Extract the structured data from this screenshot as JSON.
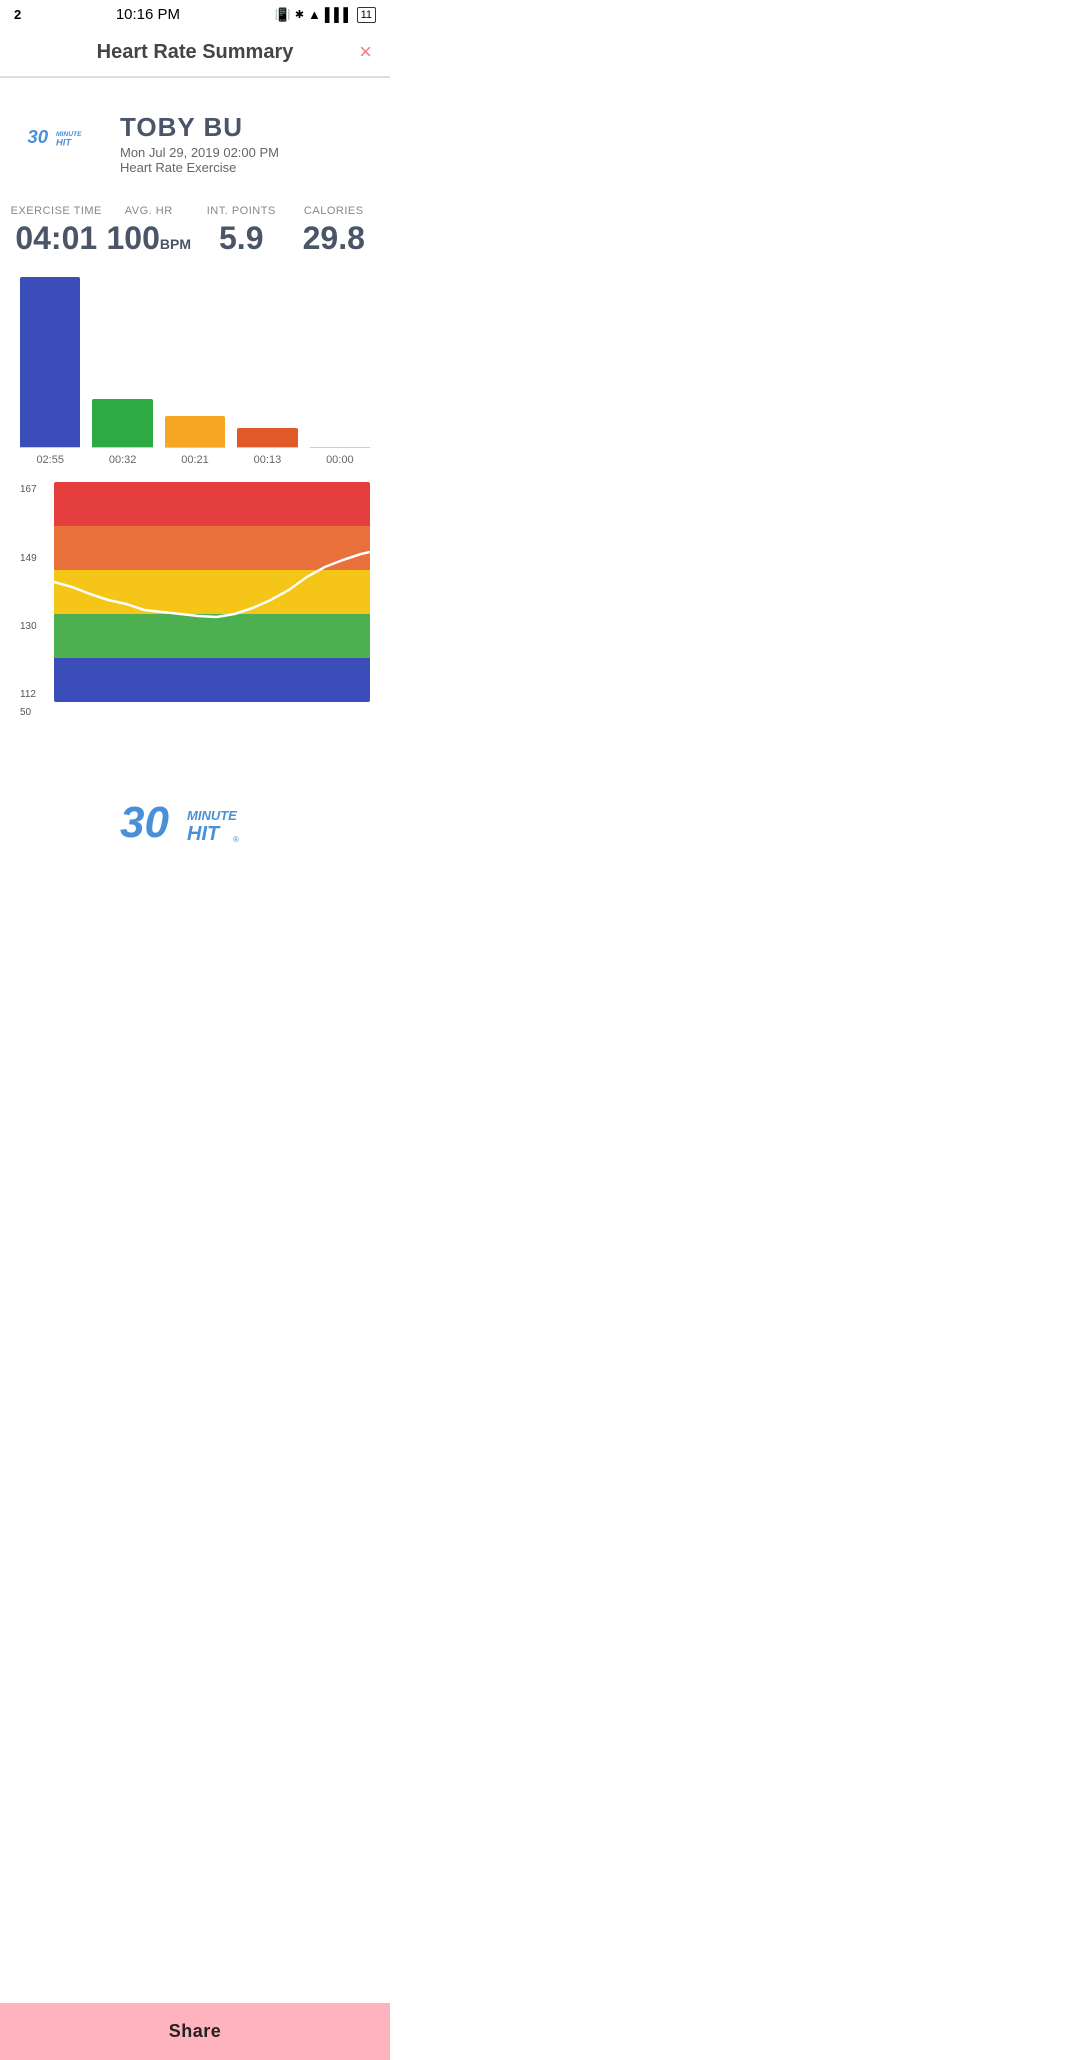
{
  "statusBar": {
    "badge": "2",
    "time": "10:16 PM",
    "battery": "11"
  },
  "header": {
    "title": "Heart Rate Summary",
    "closeIcon": "×"
  },
  "profile": {
    "name": "TOBY BU",
    "date": "Mon Jul 29, 2019 02:00 PM",
    "exerciseType": "Heart Rate Exercise"
  },
  "stats": {
    "exerciseTime": {
      "label": "EXERCISE TIME",
      "value": "04:01"
    },
    "avgHR": {
      "label": "AVG. HR",
      "value": "100",
      "unit": "BPM"
    },
    "intPoints": {
      "label": "INT. POINTS",
      "value": "5.9"
    },
    "calories": {
      "label": "CALORIES",
      "value": "29.8"
    }
  },
  "barChart": {
    "bars": [
      {
        "label": "02:55",
        "color": "#3b4db8",
        "heightPct": 100
      },
      {
        "label": "00:32",
        "color": "#2eaa44",
        "heightPct": 28
      },
      {
        "label": "00:21",
        "color": "#f5a623",
        "heightPct": 18
      },
      {
        "label": "00:13",
        "color": "#e05a28",
        "heightPct": 11
      },
      {
        "label": "00:00",
        "color": "transparent",
        "heightPct": 0
      }
    ]
  },
  "hrZones": {
    "labels": [
      "167",
      "149",
      "130",
      "112",
      "50"
    ],
    "zones": [
      {
        "color": "#e53e3e"
      },
      {
        "color": "#e8703a"
      },
      {
        "color": "#f5c518"
      },
      {
        "color": "#4caf50"
      },
      {
        "color": "#3b4db8"
      }
    ]
  },
  "shareButton": {
    "label": "Share"
  }
}
